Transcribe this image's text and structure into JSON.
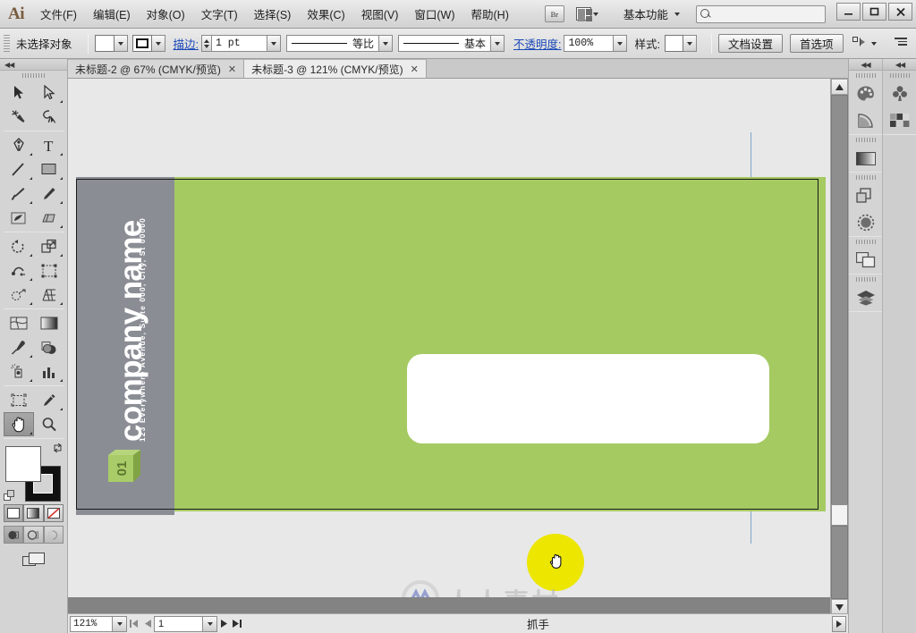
{
  "app": {
    "name": "Ai",
    "logo_color": "#7a5c3e"
  },
  "menubar": {
    "items": [
      {
        "label": "文件(F)"
      },
      {
        "label": "编辑(E)"
      },
      {
        "label": "对象(O)"
      },
      {
        "label": "文字(T)"
      },
      {
        "label": "选择(S)"
      },
      {
        "label": "效果(C)"
      },
      {
        "label": "视图(V)"
      },
      {
        "label": "窗口(W)"
      },
      {
        "label": "帮助(H)"
      }
    ],
    "bridge_label": "Br",
    "arrange_icon": "arrange-documents-icon",
    "workspace": "基本功能",
    "search_placeholder": "",
    "window_controls": {
      "minimize": "–",
      "maximize": "❐",
      "close": "✕"
    }
  },
  "controlbar": {
    "selection_status": "未选择对象",
    "fill_swatch_label": "",
    "stroke_swatch_label": "",
    "stroke_link": "描边:",
    "stroke_weight": "1 pt",
    "stroke_profile": "等比",
    "brush_definition": "基本",
    "opacity_link": "不透明度:",
    "opacity_value": "100%",
    "style_label": "样式:",
    "doc_setup_btn": "文档设置",
    "preferences_btn": "首选项",
    "align_icon": "align-selection-icon",
    "panel_menu_icon": "panel-menu-icon"
  },
  "tabs": [
    {
      "label": "未标题-2 @ 67% (CMYK/预览)",
      "close": "✕",
      "active": false
    },
    {
      "label": "未标题-3 @ 121% (CMYK/预览)",
      "close": "✕",
      "active": true
    }
  ],
  "toolbar": {
    "collapse_arrows": "◀◀",
    "groups": [
      [
        {
          "name": "selection-tool",
          "selected": false,
          "more": false
        },
        {
          "name": "direct-selection-tool",
          "selected": false,
          "more": true
        },
        {
          "name": "magic-wand-tool",
          "selected": false,
          "more": false
        },
        {
          "name": "lasso-tool",
          "selected": false,
          "more": false
        }
      ],
      [
        {
          "name": "pen-tool",
          "selected": false,
          "more": true
        },
        {
          "name": "type-tool",
          "selected": false,
          "more": true
        },
        {
          "name": "line-segment-tool",
          "selected": false,
          "more": true
        },
        {
          "name": "rectangle-tool",
          "selected": false,
          "more": true
        },
        {
          "name": "paintbrush-tool",
          "selected": false,
          "more": true
        },
        {
          "name": "pencil-tool",
          "selected": false,
          "more": true
        },
        {
          "name": "blob-brush-tool",
          "selected": false,
          "more": false
        },
        {
          "name": "eraser-tool",
          "selected": false,
          "more": true
        }
      ],
      [
        {
          "name": "rotate-tool",
          "selected": false,
          "more": true
        },
        {
          "name": "scale-tool",
          "selected": false,
          "more": true
        },
        {
          "name": "width-tool",
          "selected": false,
          "more": true
        },
        {
          "name": "free-transform-tool",
          "selected": false,
          "more": false
        },
        {
          "name": "shape-builder-tool",
          "selected": false,
          "more": true
        },
        {
          "name": "perspective-grid-tool",
          "selected": false,
          "more": true
        }
      ],
      [
        {
          "name": "mesh-tool",
          "selected": false,
          "more": false
        },
        {
          "name": "gradient-tool",
          "selected": false,
          "more": false
        },
        {
          "name": "eyedropper-tool",
          "selected": false,
          "more": true
        },
        {
          "name": "blend-tool",
          "selected": false,
          "more": false
        },
        {
          "name": "symbol-sprayer-tool",
          "selected": false,
          "more": true
        },
        {
          "name": "column-graph-tool",
          "selected": false,
          "more": true
        }
      ],
      [
        {
          "name": "artboard-tool",
          "selected": false,
          "more": false
        },
        {
          "name": "slice-tool",
          "selected": false,
          "more": true
        },
        {
          "name": "hand-tool",
          "selected": true,
          "more": true
        },
        {
          "name": "zoom-tool",
          "selected": false,
          "more": false
        }
      ]
    ],
    "color": {
      "fill": "#ffffff",
      "stroke": "#111111",
      "swap_icon": "swap-fill-stroke-icon",
      "default_icon": "default-fill-stroke-icon"
    },
    "modes": [
      {
        "name": "color-mode",
        "active": true
      },
      {
        "name": "gradient-mode",
        "active": false
      },
      {
        "name": "none-mode",
        "active": false
      }
    ],
    "draw_modes": [
      {
        "name": "draw-normal",
        "active": true
      },
      {
        "name": "draw-behind",
        "active": false
      },
      {
        "name": "draw-inside",
        "active": false
      }
    ],
    "screen_mode": "change-screen-mode-icon"
  },
  "dock": {
    "collapse_arrows": "◀◀",
    "left_column": [
      {
        "name": "color-panel-icon"
      },
      {
        "name": "color-guide-panel-icon"
      },
      {
        "name": "gradient-panel-icon"
      },
      {
        "name": "pathfinder-panel-icon"
      },
      {
        "name": "transparency-panel-icon"
      },
      {
        "name": "align-panel-icon"
      },
      {
        "name": "layers-panel-icon"
      }
    ],
    "right_column": [
      {
        "name": "brushes-panel-icon"
      },
      {
        "name": "swatches-panel-icon"
      }
    ]
  },
  "artwork": {
    "company_name": "company name",
    "address": "123 Everywhere Avenue, Suite 000, City, St 00000",
    "logo_label": "01",
    "colors": {
      "green": "#a5ca62",
      "gray": "#8a8d94",
      "white": "#ffffff",
      "logo_green": "#a5ca62",
      "logo_green_dark": "#6f8c3d"
    }
  },
  "cursor": {
    "tool": "hand-cursor",
    "highlight_color": "#ece600"
  },
  "watermark": {
    "text": "人人素材"
  },
  "statusbar": {
    "zoom": "121%",
    "page": "1",
    "tool_name": "抓手",
    "nav_first": "|◀",
    "nav_prev": "◀",
    "nav_next": "▶",
    "nav_last": "▶|"
  }
}
